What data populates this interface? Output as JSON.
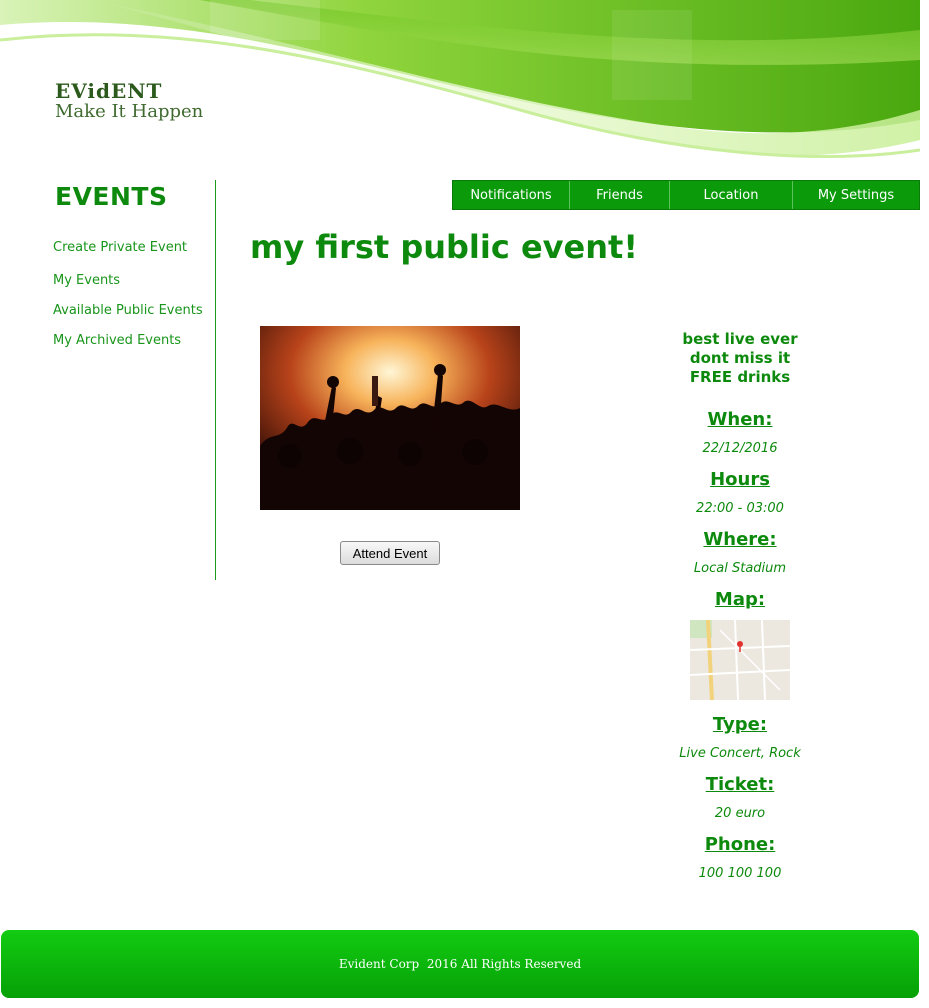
{
  "brand": {
    "name": "EVidENT",
    "tagline": "Make It Happen"
  },
  "sidebar": {
    "title": "EVENTS",
    "items": [
      {
        "label": "Create Private Event"
      },
      {
        "label": "My Events"
      },
      {
        "label": "Available Public Events"
      },
      {
        "label": "My Archived Events"
      }
    ]
  },
  "nav": {
    "items": [
      {
        "label": "Notifications"
      },
      {
        "label": "Friends"
      },
      {
        "label": "Location"
      },
      {
        "label": "My Settings"
      }
    ]
  },
  "event": {
    "title": "my first public event!",
    "attend_label": "Attend  Event",
    "description": [
      "best live ever",
      "dont miss it",
      "FREE drinks"
    ],
    "when_label": "When:",
    "when_value": "22/12/2016",
    "hours_label": "Hours",
    "hours_value": "22:00 - 03:00",
    "where_label": "Where:",
    "where_value": "Local Stadium",
    "map_label": "Map:",
    "type_label": "Type:",
    "type_value": "Live Concert, Rock",
    "ticket_label": "Ticket:",
    "ticket_value": "20 euro",
    "phone_label": "Phone:",
    "phone_value": "100 100 100"
  },
  "footer": {
    "text": "Evident Corp  2016 All Rights Reserved"
  },
  "colors": {
    "primary_green": "#0d8a0d",
    "nav_green": "#0a9a0a",
    "footer_green": "#12cc12"
  }
}
